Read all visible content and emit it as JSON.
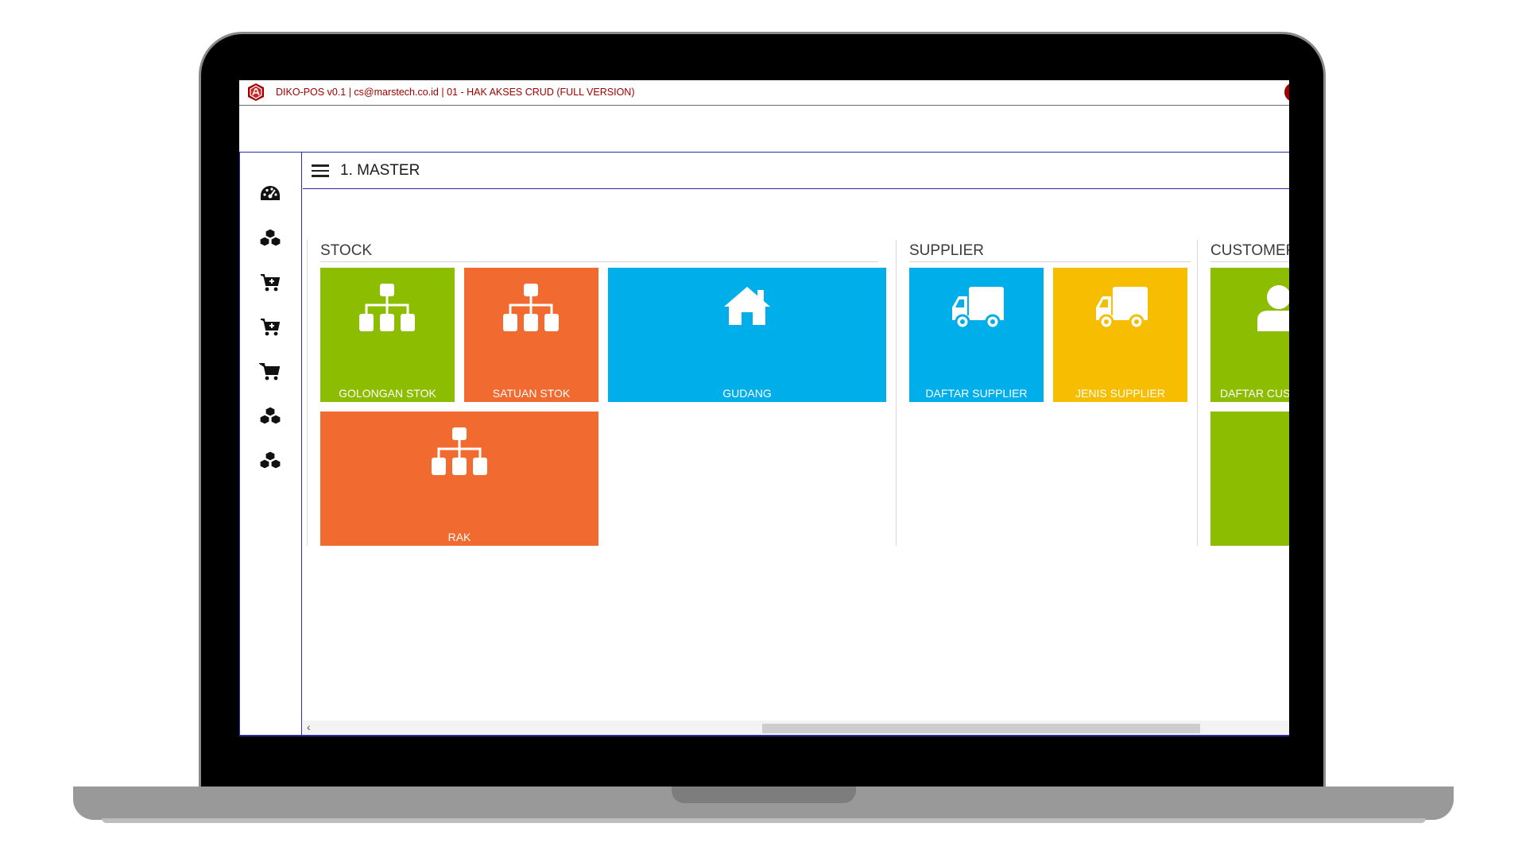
{
  "window": {
    "title": "DIKO-POS v0.1 | cs@marstech.co.id | 01 - HAK AKSES CRUD (FULL VERSION)"
  },
  "header": {
    "title": "1. MASTER"
  },
  "sidebar": {
    "items": [
      {
        "icon": "dashboard-icon"
      },
      {
        "icon": "cubes-icon"
      },
      {
        "icon": "cart-add-icon"
      },
      {
        "icon": "cart-add-icon"
      },
      {
        "icon": "cart-icon"
      },
      {
        "icon": "cubes-icon"
      },
      {
        "icon": "cubes-icon"
      }
    ]
  },
  "groups": {
    "stock": {
      "title": "STOCK",
      "tiles": [
        {
          "label": "GOLONGAN STOK",
          "icon": "sitemap-icon",
          "color": "#8cbd00"
        },
        {
          "label": "SATUAN STOK",
          "icon": "sitemap-icon",
          "color": "#f16a30"
        },
        {
          "label": "GUDANG",
          "icon": "home-icon",
          "color": "#00aeea"
        },
        {
          "label": "RAK",
          "icon": "sitemap-icon",
          "color": "#f16a30"
        }
      ]
    },
    "supplier": {
      "title": "SUPPLIER",
      "tiles": [
        {
          "label": "DAFTAR SUPPLIER",
          "icon": "truck-icon",
          "color": "#00aeea"
        },
        {
          "label": "JENIS SUPPLIER",
          "icon": "truck-icon",
          "color": "#f7bd00"
        }
      ]
    },
    "customer": {
      "title": "CUSTOMER",
      "tiles": [
        {
          "label": "DAFTAR CUSTOMER",
          "icon": "user-icon",
          "color": "#8cbd00"
        },
        {
          "label": "",
          "icon": "",
          "color": "#8cbd00"
        }
      ]
    }
  },
  "scrollbar": {
    "left_arrow": "‹"
  },
  "colors": {
    "green": "#8cbd00",
    "orange": "#f16a30",
    "blue": "#00aeea",
    "yellow": "#f7bd00",
    "title_red": "#a00000",
    "border_blue": "#2b2ba8"
  }
}
